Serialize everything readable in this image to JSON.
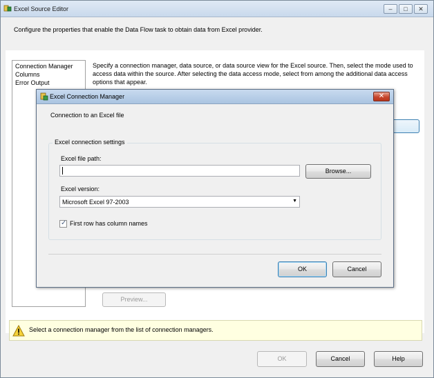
{
  "window": {
    "title": "Excel Source Editor",
    "minimize_glyph": "–",
    "maximize_glyph": "□",
    "close_glyph": "✕"
  },
  "intro_text": "Configure the properties that enable the Data Flow task to obtain data from Excel provider.",
  "nav": {
    "items": [
      {
        "label": "Connection Manager"
      },
      {
        "label": "Columns"
      },
      {
        "label": "Error Output"
      }
    ]
  },
  "description": "Specify a connection manager, data source, or data source view for the Excel source. Then, select the mode used to access data within the source. After selecting the data access mode, select from among the additional data access options that appear.",
  "preview_label": "Preview...",
  "status": {
    "message": "Select a connection manager from the list of connection managers."
  },
  "footer": {
    "ok_label": "OK",
    "cancel_label": "Cancel",
    "help_label": "Help"
  },
  "dialog": {
    "title": "Excel Connection Manager",
    "close_glyph": "✕",
    "heading": "Connection to an Excel file",
    "group_title": "Excel connection settings",
    "file_path_label": "Excel file path:",
    "file_path_value": "",
    "browse_label": "Browse...",
    "version_label": "Excel version:",
    "version_value": "Microsoft Excel 97-2003",
    "first_row_label": "First row has column names",
    "first_row_checked": true,
    "ok_label": "OK",
    "cancel_label": "Cancel"
  }
}
